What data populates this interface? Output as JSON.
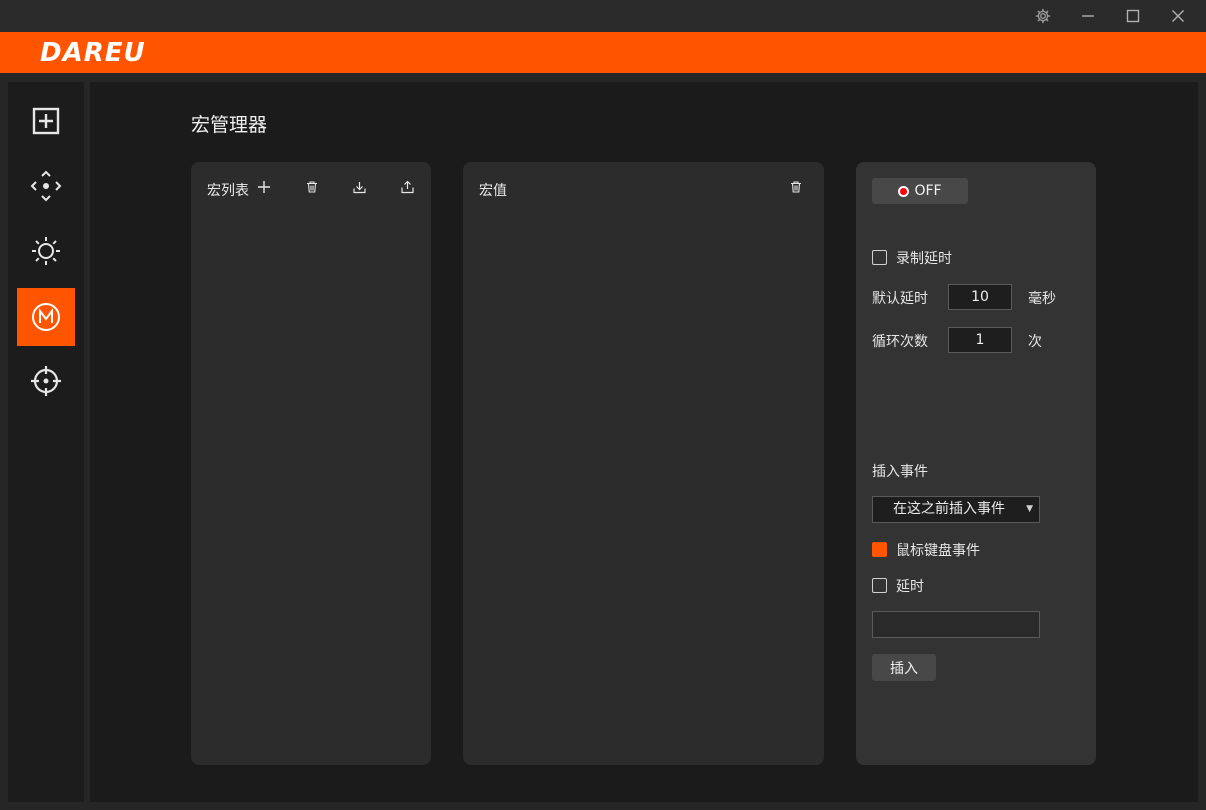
{
  "brand": {
    "logo_text": "DAREU",
    "accent": "#ff5500"
  },
  "window": {
    "controls": [
      "gear-icon",
      "minimize-icon",
      "maximize-icon",
      "close-icon"
    ]
  },
  "sidebar": {
    "items": [
      {
        "icon": "plus-square-icon",
        "active": false
      },
      {
        "icon": "move-arrows-icon",
        "active": false
      },
      {
        "icon": "brightness-icon",
        "active": false
      },
      {
        "icon": "macro-m-icon",
        "active": true
      },
      {
        "icon": "crosshair-icon",
        "active": false
      }
    ]
  },
  "page": {
    "title": "宏管理器"
  },
  "macro_list": {
    "header": "宏列表",
    "actions": [
      "add-icon",
      "trash-icon",
      "import-icon",
      "export-icon"
    ]
  },
  "macro_values": {
    "header": "宏值",
    "actions": [
      "trash-icon"
    ]
  },
  "settings": {
    "record_toggle": "OFF",
    "record_delay_label": "录制延时",
    "default_delay_label": "默认延时",
    "default_delay_value": "10",
    "default_delay_unit": "毫秒",
    "loop_count_label": "循环次数",
    "loop_count_value": "1",
    "loop_count_unit": "次",
    "insert_event_label": "插入事件",
    "insert_select_value": "在这之前插入事件",
    "mouse_keyboard_label": "鼠标键盘事件",
    "delay_label": "延时",
    "delay_input_value": "",
    "insert_button": "插入"
  }
}
